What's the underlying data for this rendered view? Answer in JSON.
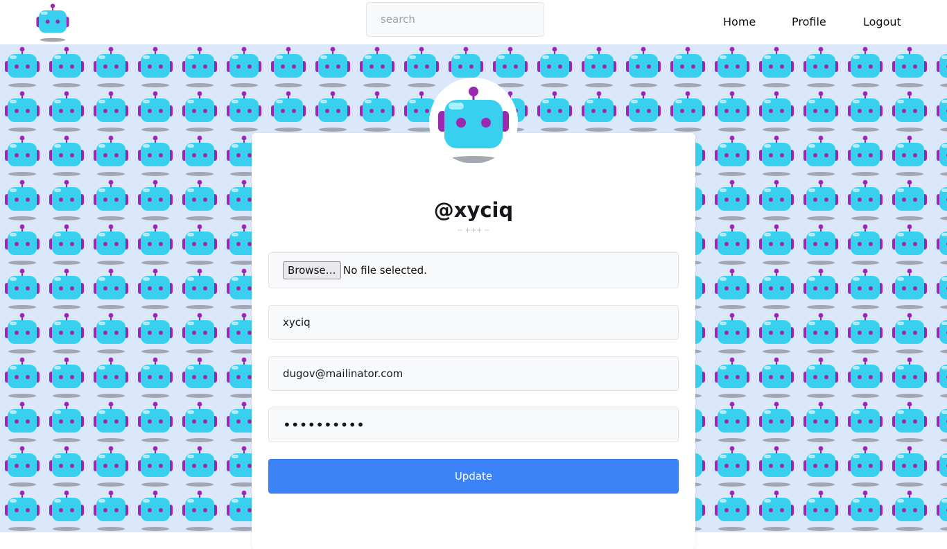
{
  "navbar": {
    "logo_icon": "robot-icon",
    "search": {
      "placeholder": "search",
      "value": ""
    },
    "links": {
      "home": "Home",
      "profile": "Profile",
      "logout": "Logout"
    }
  },
  "profile": {
    "avatar_icon": "robot-icon",
    "username_display": "@xyciq",
    "divider": "-- +++ --",
    "file_input": {
      "button_label": "Browse…",
      "status": "No file selected."
    },
    "name_value": "xyciq",
    "email_value": "dugov@mailinator.com",
    "password_value": "••••••••••",
    "update_label": "Update"
  },
  "colors": {
    "background_pattern": "#dbe7fb",
    "robot_body": "#38d0ee",
    "robot_accent": "#9c27b0",
    "button_primary": "#3b82f6",
    "card": "#ffffff"
  }
}
